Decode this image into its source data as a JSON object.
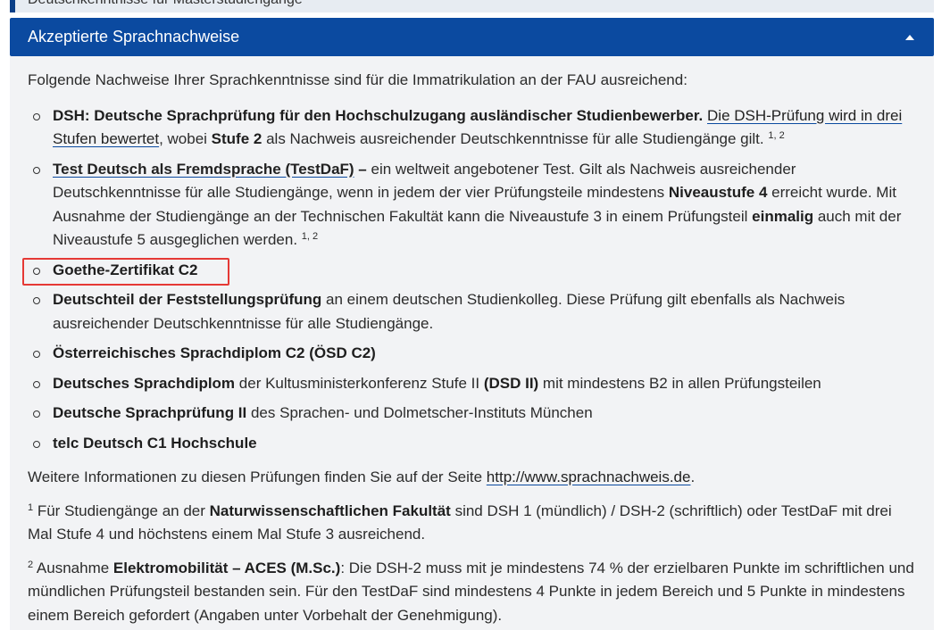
{
  "prev_panel": {
    "title": "Deutschkenntnisse für Masterstudiengänge"
  },
  "accordion": {
    "title": "Akzeptierte Sprachnachweise",
    "icon": "caret-up-icon"
  },
  "intro": "Folgende Nachweise Ihrer Sprachkenntnisse sind für die Immatrikulation an der FAU ausreichend:",
  "items": {
    "dsh": {
      "bold": "DSH: Deutsche Sprachprüfung für den Hochschulzugang ausländischer Studienbewerber.",
      "link": "Die DSH-Prüfung wird in drei Stufen bewertet",
      "t1": ", wobei ",
      "b2": "Stufe 2",
      "t2": " als Nachweis ausreichender Deutschkenntnisse für alle Studiengänge gilt. ",
      "sup": "1, 2"
    },
    "testdaf": {
      "link": "Test Deutsch als Fremdsprache (TestDaF)",
      "dash": " –",
      "t1": " ein weltweit angebotener Test. Gilt als Nachweis ausreichender Deutschkenntnisse für alle Studiengänge, wenn in jedem der vier Prüfungsteile mindestens ",
      "b1": "Niveaustufe 4",
      "t2": " erreicht wurde. Mit Ausnahme der Studiengänge an der Technischen Fakultät kann die Niveaustufe 3 in einem Prüfungsteil ",
      "b2": "einmalig",
      "t3": " auch mit der Niveaustufe 5 ausgeglichen werden. ",
      "sup": "1, 2"
    },
    "goethe": {
      "bold": "Goethe-Zertifikat C2"
    },
    "feststellung": {
      "bold": "Deutschteil der Feststellungsprüfung",
      "t1": " an einem deutschen Studienkolleg. Diese Prüfung gilt ebenfalls als Nachweis ausreichender Deutschkenntnisse für alle Studiengänge."
    },
    "osd": {
      "bold": "Österreichisches Sprachdiplom C2 (ÖSD C2)"
    },
    "dsd": {
      "bold": "Deutsches Sprachdiplom",
      "t1": " der Kultusministerkonferenz Stufe II ",
      "b2": "(DSD II)",
      "t2": " mit mindestens B2 in allen Prüfungsteilen"
    },
    "dsp": {
      "bold": "Deutsche Sprachprüfung II",
      "t1": " des Sprachen- und Dolmetscher-Instituts München"
    },
    "telc": {
      "bold": "telc Deutsch C1 Hochschule"
    }
  },
  "more_info": {
    "t1": "Weitere Informationen zu diesen Prüfungen finden Sie auf der Seite ",
    "link": "http://www.sprachnachweis.de",
    "t2": "."
  },
  "footnote1": {
    "sup": "1",
    "t1": " Für Studiengänge an der ",
    "b1": "Naturwissenschaftlichen Fakultät",
    "t2": " sind DSH 1 (mündlich) / DSH-2 (schriftlich) oder TestDaF mit drei Mal Stufe 4 und höchstens einem Mal Stufe 3 ausreichend."
  },
  "footnote2": {
    "sup": "2",
    "t1": " Ausnahme ",
    "b1": "Elektromobilität – ACES (M.Sc.)",
    "t2": ": Die DSH-2 muss mit je mindestens 74 % der erzielbaren Punkte im schriftlichen und mündlichen Prüfungsteil bestanden sein. Für den TestDaF sind mindestens 4 Punkte in jedem Bereich und 5 Punkte in mindestens einem Bereich gefordert (Angaben unter Vorbehalt der Genehmigung)."
  },
  "highlight_color": "#e53935",
  "accent_color": "#0b4aa0"
}
